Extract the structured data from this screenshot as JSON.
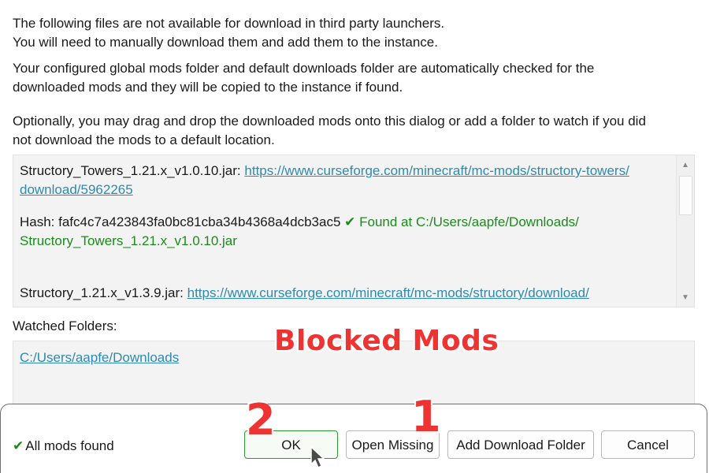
{
  "intro": {
    "line1": "The following files are not available for download in third party launchers.",
    "line2": "You will need to manually download them and add them to the instance.",
    "folder_note_1": "Your configured global mods folder and default downloads folder are automatically checked for the",
    "folder_note_2": "downloaded mods and they will be copied to the instance if found.",
    "drag_note_1": "Optionally, you may drag and drop the downloaded mods onto this dialog or add a folder to watch if you did",
    "drag_note_2": "not download the mods to a default location."
  },
  "mods": [
    {
      "filename": "Structory_Towers_1.21.x_v1.0.10.jar:",
      "url_line1": "https://www.curseforge.com/minecraft/mc-mods/structory-towers/",
      "url_line2": "download/5962265",
      "hash_label": "Hash: fafc4c7a423843fa0bc81cba34b4368a4dcb3ac5",
      "found_icon": "✔",
      "found_text_1": "Found at C:/Users/aapfe/Downloads/",
      "found_text_2": "Structory_Towers_1.21.x_v1.0.10.jar"
    },
    {
      "filename": "Structory_1.21.x_v1.3.9.jar:",
      "url_line1": "https://www.curseforge.com/minecraft/mc-mods/structory/download/"
    }
  ],
  "scrollbar": {
    "up_icon": "▲",
    "down_icon": "▼"
  },
  "watched": {
    "label": "Watched Folders:",
    "folders": [
      "C:/Users/aapfe/Downloads"
    ]
  },
  "annotations": {
    "title": "Blocked Mods",
    "step1": "1",
    "step2": "2",
    "color": "#ee3333"
  },
  "footer": {
    "status_icon": "✔",
    "status_text": "All mods found",
    "buttons": {
      "ok": "OK",
      "open_missing": "Open Missing",
      "add_folder": "Add Download Folder",
      "cancel": "Cancel"
    }
  },
  "colors": {
    "link": "#2e8ab0",
    "found": "#1d8a1d",
    "ok_border": "#2e9b2e"
  }
}
